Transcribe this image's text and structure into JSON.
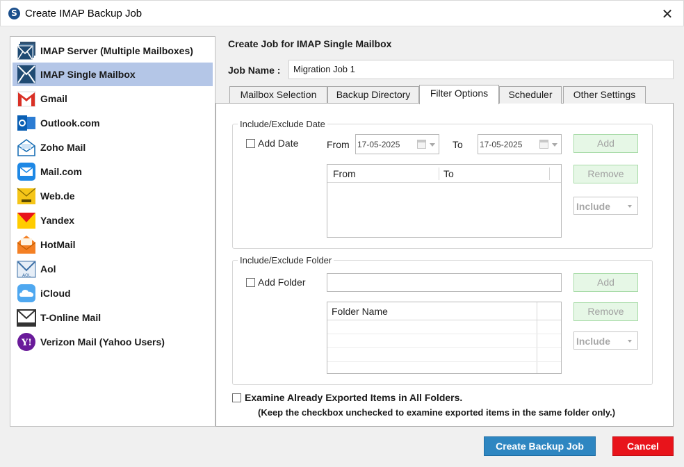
{
  "window": {
    "title": "Create IMAP Backup Job",
    "app_icon_letter": "S"
  },
  "sidebar": {
    "items": [
      {
        "label": "IMAP Server (Multiple Mailboxes)",
        "icon": "imap-server-icon"
      },
      {
        "label": "IMAP Single Mailbox",
        "icon": "imap-single-icon",
        "selected": true
      },
      {
        "label": "Gmail",
        "icon": "gmail-icon"
      },
      {
        "label": "Outlook.com",
        "icon": "outlook-icon"
      },
      {
        "label": "Zoho Mail",
        "icon": "zoho-mail-icon"
      },
      {
        "label": "Mail.com",
        "icon": "mail-com-icon"
      },
      {
        "label": "Web.de",
        "icon": "web-de-icon"
      },
      {
        "label": "Yandex",
        "icon": "yandex-icon"
      },
      {
        "label": "HotMail",
        "icon": "hotmail-icon"
      },
      {
        "label": "Aol",
        "icon": "aol-icon"
      },
      {
        "label": "iCloud",
        "icon": "icloud-icon"
      },
      {
        "label": "T-Online Mail",
        "icon": "t-online-icon"
      },
      {
        "label": "Verizon Mail (Yahoo Users)",
        "icon": "verizon-icon"
      }
    ]
  },
  "main": {
    "title": "Create Job for IMAP Single Mailbox",
    "job_name_label": "Job Name :",
    "job_name_value": "Migration Job 1"
  },
  "tabs": [
    {
      "label": "Mailbox Selection"
    },
    {
      "label": "Backup Directory"
    },
    {
      "label": "Filter Options",
      "active": true
    },
    {
      "label": "Scheduler"
    },
    {
      "label": "Other Settings"
    }
  ],
  "date_group": {
    "title": "Include/Exclude Date",
    "checkbox_label": "Add Date",
    "from_label": "From",
    "from_value": "17-05-2025",
    "to_label": "To",
    "to_value": "17-05-2025",
    "grid_headers": [
      "From",
      "To"
    ],
    "add_label": "Add",
    "remove_label": "Remove",
    "mode_value": "Include"
  },
  "folder_group": {
    "title": "Include/Exclude Folder",
    "checkbox_label": "Add Folder",
    "folder_value": "",
    "grid_header": "Folder Name",
    "add_label": "Add",
    "remove_label": "Remove",
    "mode_value": "Include"
  },
  "examine": {
    "label": "Examine Already Exported Items in All Folders.",
    "note": "(Keep the checkbox unchecked to examine exported items in the same folder only.)"
  },
  "footer": {
    "create_label": "Create Backup Job",
    "cancel_label": "Cancel"
  },
  "colors": {
    "selected_row": "#b4c6e7",
    "primary_button": "#2e86c1",
    "cancel_button": "#e8141b",
    "disabled_button_bg": "#e6f7e6"
  }
}
